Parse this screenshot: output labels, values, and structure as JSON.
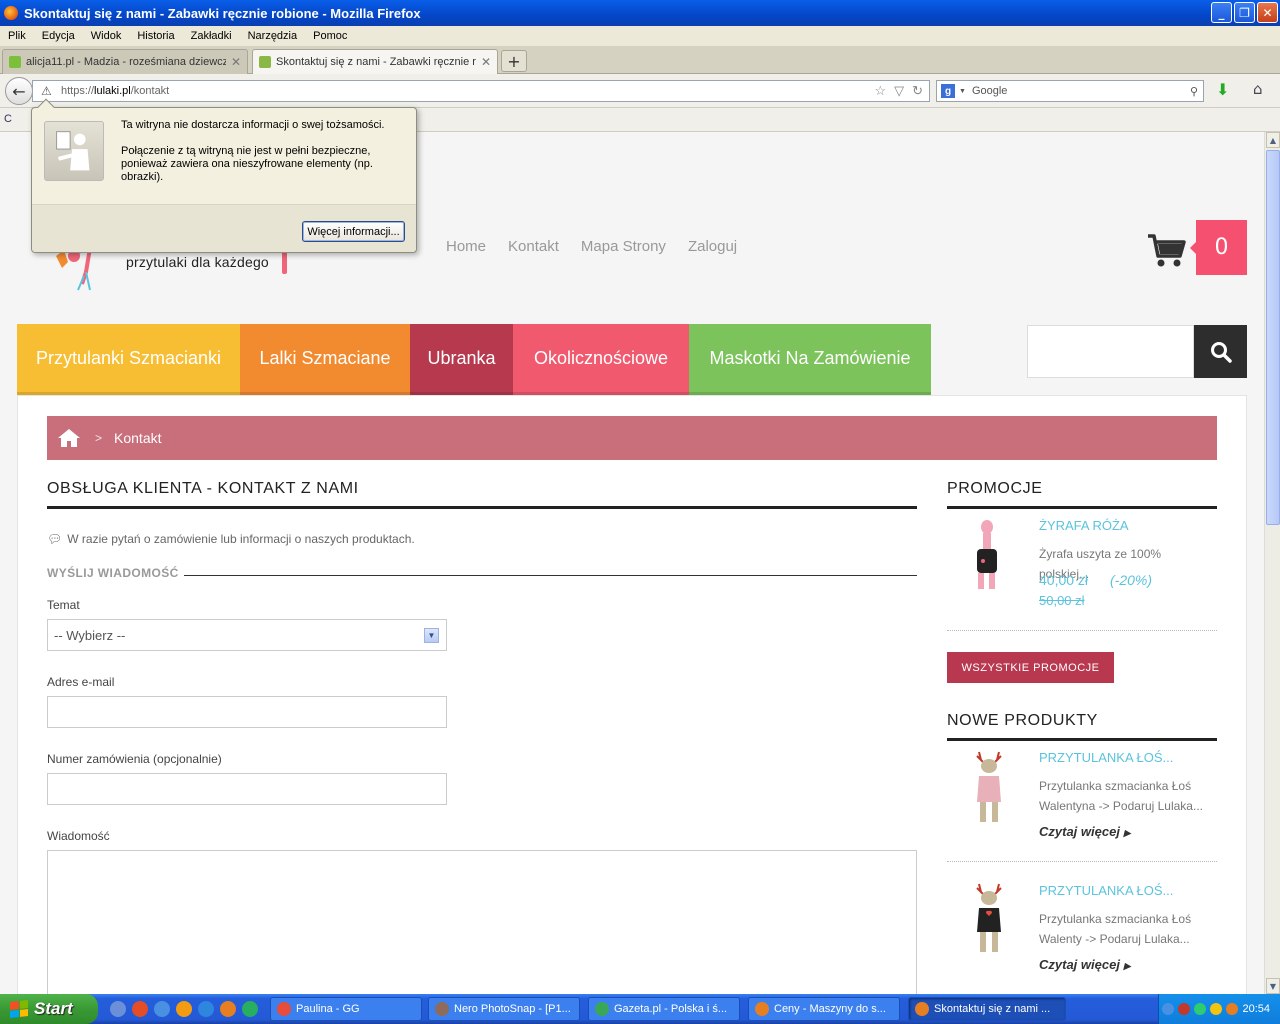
{
  "window": {
    "title": "Skontaktuj się z nami - Zabawki ręcznie robione - Mozilla Firefox"
  },
  "menu": [
    "Plik",
    "Edycja",
    "Widok",
    "Historia",
    "Zakładki",
    "Narzędzia",
    "Pomoc"
  ],
  "tabs": [
    {
      "label": "alicja11.pl - Madzia - roześmiana dziewcz...",
      "active": false
    },
    {
      "label": "Skontaktuj się z nami - Zabawki ręcznie r...",
      "active": true
    }
  ],
  "url": {
    "prefix": "https://",
    "host": "lulaki.pl",
    "path": "/kontakt"
  },
  "search": {
    "engine": "Google",
    "placeholder": "Google"
  },
  "bookmark_partial": "C",
  "identity_popup": {
    "line1": "Ta witryna nie dostarcza informacji o swej tożsamości.",
    "line2": "Połączenie z tą witryną nie jest w pełni bezpieczne, ponieważ zawiera ona nieszyfrowane elementy (np. obrazki).",
    "button": "Więcej informacji..."
  },
  "site": {
    "tagline": "przytulaki dla każdego",
    "nav": [
      "Home",
      "Kontakt",
      "Mapa Strony",
      "Zaloguj"
    ],
    "cart_count": "0",
    "categories": [
      {
        "label": "Przytulanki Szmacianki",
        "color": "#f7bd33"
      },
      {
        "label": "Lalki Szmaciane",
        "color": "#f28b30"
      },
      {
        "label": "Ubranka",
        "color": "#b6394e"
      },
      {
        "label": "Okolicznościowe",
        "color": "#f0596e"
      },
      {
        "label": "Maskotki Na Zamówienie",
        "color": "#7dc35c"
      }
    ],
    "search_placeholder": ""
  },
  "breadcrumb": {
    "current": "Kontakt",
    "separator": ">"
  },
  "contact": {
    "heading": "OBSŁUGA KLIENTA - KONTAKT Z NAMI",
    "intro": "W razie pytań o zamówienie lub informacji o naszych produktach.",
    "subheading": "WYŚLIJ WIADOMOŚĆ",
    "subject_label": "Temat",
    "subject_value": "-- Wybierz --",
    "email_label": "Adres e-mail",
    "email_value": "",
    "order_label": "Numer zamówienia (opcjonalnie)",
    "order_value": "",
    "message_label": "Wiadomość",
    "message_value": ""
  },
  "sidebar": {
    "promo_heading": "PROMOCJE",
    "promo_product": {
      "name": "ŻYRAFA RÓŻA",
      "desc": "Żyrafa uszyta ze 100% polskiej...",
      "price": "40,00 zł",
      "discount": "(-20%)",
      "old_price": "50,00 zł"
    },
    "all_promos_button": "WSZYSTKIE PROMOCJE",
    "new_heading": "NOWE PRODUKTY",
    "new_products": [
      {
        "name": "PRZYTULANKA ŁOŚ...",
        "desc": "Przytulanka szmacianka Łoś Walentyna -> Podaruj Lulaka...",
        "more": "Czytaj więcej"
      },
      {
        "name": "PRZYTULANKA ŁOŚ...",
        "desc": "Przytulanka szmacianka Łoś Walenty -> Podaruj Lulaka...",
        "more": "Czytaj więcej"
      }
    ]
  },
  "taskbar": {
    "start": "Start",
    "tasks": [
      "Paulina - GG",
      "Nero PhotoSnap - [P1...",
      "Gazeta.pl - Polska i ś...",
      "Ceny - Maszyny do s...",
      "Skontaktuj się z nami ..."
    ],
    "clock": "20:54"
  }
}
